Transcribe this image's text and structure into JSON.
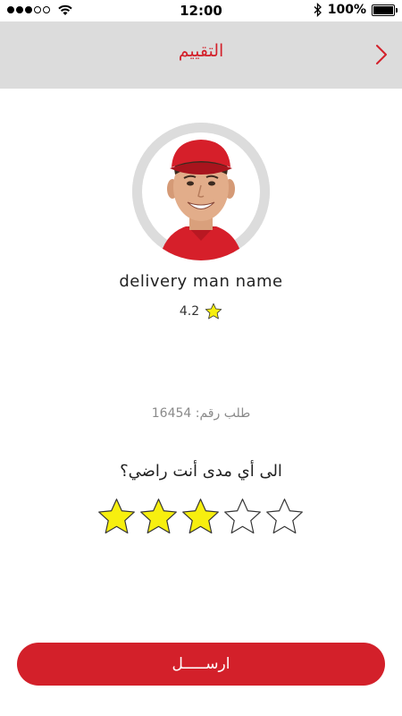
{
  "status_bar": {
    "time": "12:00",
    "battery": "100%"
  },
  "header": {
    "title": "التقييم",
    "back_icon": "chevron-right-icon"
  },
  "driver": {
    "name": "delivery man name",
    "rating": "4.2"
  },
  "order": {
    "label": "طلب رقم: 16454"
  },
  "rating_prompt": {
    "question": "الى أي مدى أنت راضي؟",
    "selected": 3,
    "max": 5
  },
  "submit": {
    "label": "ارســـــل"
  },
  "colors": {
    "accent": "#d3202a",
    "star_filled": "#f7ef0f",
    "header_bg": "#dcdcdc"
  }
}
